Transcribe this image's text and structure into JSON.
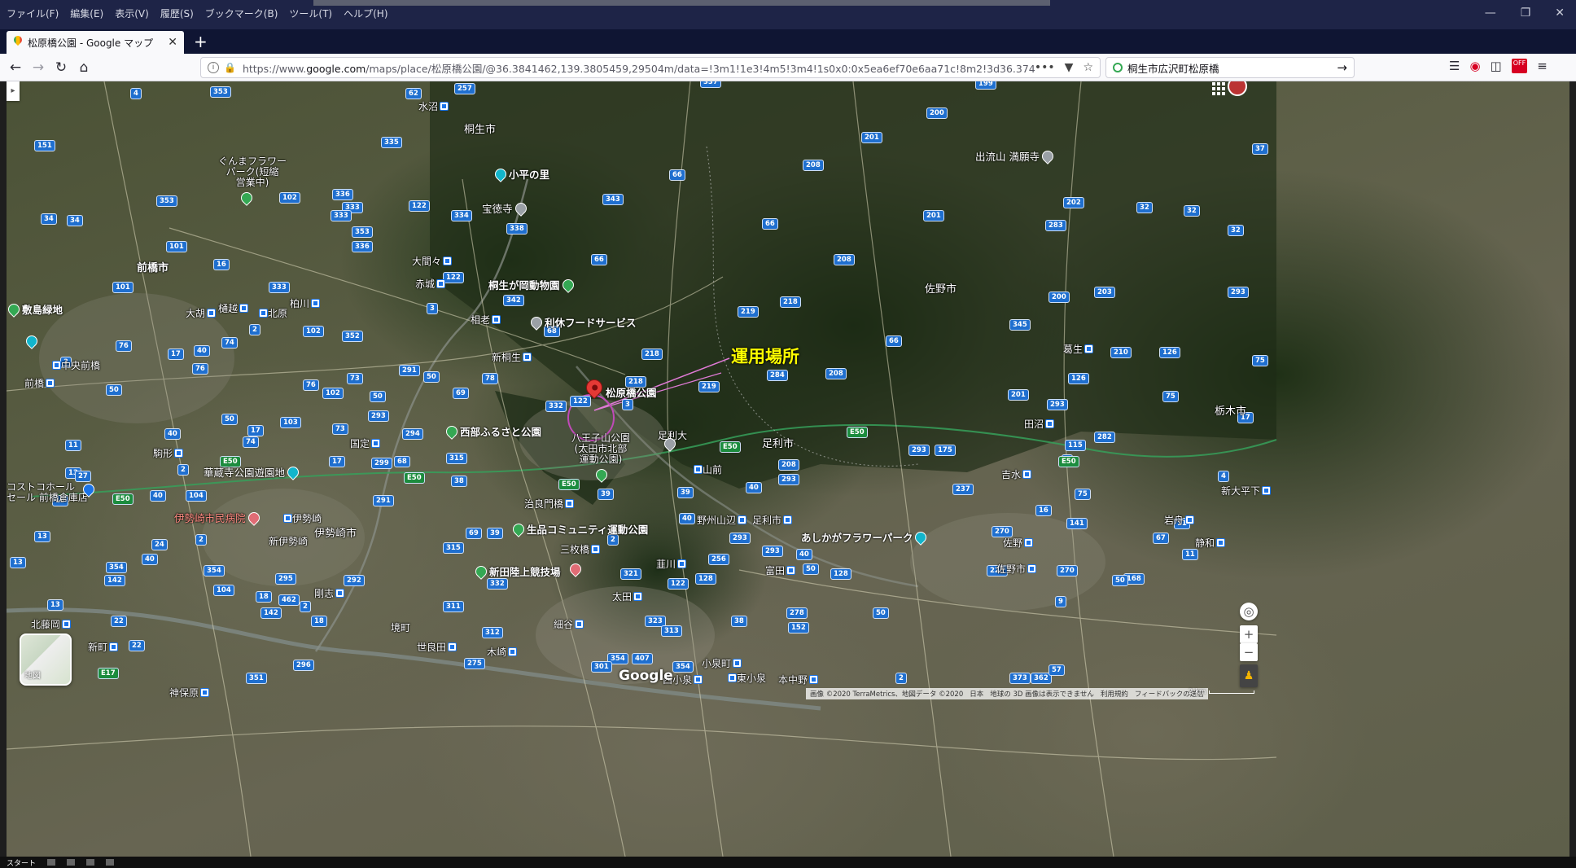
{
  "window": {
    "menu": [
      "ファイル(F)",
      "編集(E)",
      "表示(V)",
      "履歴(S)",
      "ブックマーク(B)",
      "ツール(T)",
      "ヘルプ(H)"
    ],
    "controls": [
      "—",
      "❐",
      "✕"
    ]
  },
  "tab": {
    "title": "松原橋公園 - Google マップ",
    "close": "✕",
    "new_tab": "+"
  },
  "nav": {
    "url_prefix": "https://www.",
    "url_host": "google.com",
    "url_path": "/maps/place/松原橋公園/@36.3841462,139.3805459,29504m/data=!3m1!1e3!4m5!3m4!1s0x0:0x5ea6ef70e6aa71c!8m2!3d36.3744",
    "search_value": "桐生市広沢町松原橋",
    "more": "•••"
  },
  "map": {
    "operation_label": "運用場所",
    "place_name": "松原橋公園",
    "layer_card_label": "地図",
    "google_logo": "Google",
    "attribution": [
      "画像 ©2020 TerraMetrics、地図データ ©2020",
      "日本",
      "地球の 3D 画像は表示できません",
      "利用規約",
      "フィードバックの送信"
    ],
    "scale": "2 km",
    "zoom_in": "+",
    "zoom_out": "−",
    "labels": {
      "kiryu": "桐生市",
      "maebashi": "前橋市",
      "ota": "太田市",
      "ashikaga": "足利市",
      "sano": "佐野市",
      "tochigi": "栃木市",
      "isesaki": "伊勢崎市",
      "koheinosato": "小平の里",
      "hotokuji": "宝徳寺",
      "kiryuzoo": "桐生が岡動物園",
      "rikyu": "利休フードサービス",
      "hachiojiyama": "八王子山公園\n(太田市北部\n運動公園)",
      "seibu": "西部ふるさと公園",
      "seihin": "生品コミュニティ運動公園",
      "nitta": "新田陸上競技場",
      "flowerpark": "あしかがフラワーパーク",
      "izurusan": "出流山 満願寺",
      "kurumaflower": "ぐんまフラワー\nパーク(短縮\n営業中)",
      "shikishima": "敷島緑地",
      "kezoji": "華蔵寺公園遊園地",
      "costco": "コストコホール\nセール 前橋倉庫店",
      "isesakihospital": "伊勢崎市民病院",
      "mizunuma": "水沼",
      "oomama": "大間々",
      "akagi": "赤城",
      "aioi": "相老",
      "shinkiryu": "新桐生",
      "ashikagadai": "足利大",
      "yamamae": "山前",
      "kunisada": "国定",
      "komagata": "駒形",
      "sanmaibashi": "三枚橋",
      "tajima": "治良門橋",
      "hosoya": "細谷",
      "kizaki": "木崎",
      "sakai": "境町",
      "serata": "世良田",
      "nirakawa": "韮川",
      "ota_st": "太田",
      "ashikagashi": "足利市",
      "noshuyamabe": "野州山辺",
      "tomita": "富田",
      "sano_st": "佐野",
      "sanoshi": "佐野市",
      "kuzuu": "葛生",
      "tanuma": "田沼",
      "yoshimizu": "吉水",
      "iwafune": "岩舟",
      "shizuwa": "静和",
      "shintochigi": "新大平下",
      "kitafujioka": "北藤岡",
      "shinmachi": "新町",
      "kamiharada": "神保原",
      "koizumi": "小泉町",
      "nishikoizumi": "西小泉",
      "higashikoizumi": "東小泉",
      "motenaka": "本中野",
      "ogoshi": "大胡",
      "kashiwa": "柏川",
      "kitahara": "北原",
      "hikawa": "樋越",
      "chuomaebashi": "中央前橋",
      "maebashi_st": "前橋",
      "shinisesaki": "新伊勢崎",
      "isesaki_st": "伊勢崎",
      "goshi": "剛志",
      "yabaguchi": "藪塚"
    }
  }
}
